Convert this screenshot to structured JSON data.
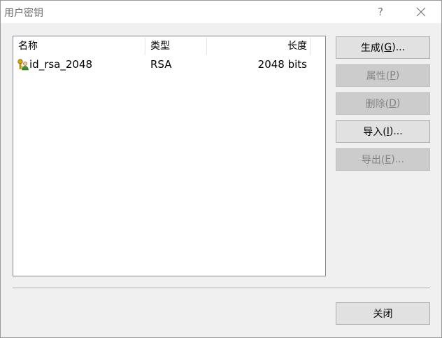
{
  "window": {
    "title": "用户密钥",
    "help_glyph": "?"
  },
  "list": {
    "columns": {
      "name": "名称",
      "type": "类型",
      "length": "长度"
    },
    "rows": [
      {
        "name": "id_rsa_2048",
        "type": "RSA",
        "length": "2048 bits",
        "icon": "key-user-icon"
      }
    ]
  },
  "buttons": {
    "generate": {
      "label": "生成(",
      "key": "G",
      "suffix": ")...",
      "enabled": true
    },
    "properties": {
      "label": "属性(",
      "key": "P",
      "suffix": ")",
      "enabled": false
    },
    "delete": {
      "label": "删除(",
      "key": "D",
      "suffix": ")",
      "enabled": false
    },
    "import": {
      "label": "导入(",
      "key": "I",
      "suffix": ")...",
      "enabled": true
    },
    "export": {
      "label": "导出(",
      "key": "E",
      "suffix": ")...",
      "enabled": false
    },
    "close": {
      "label": "关闭"
    }
  },
  "colors": {
    "disabled_text": "#838383",
    "key_icon_gold": "#d9a400",
    "user_icon_green": "#3a8f2f"
  }
}
